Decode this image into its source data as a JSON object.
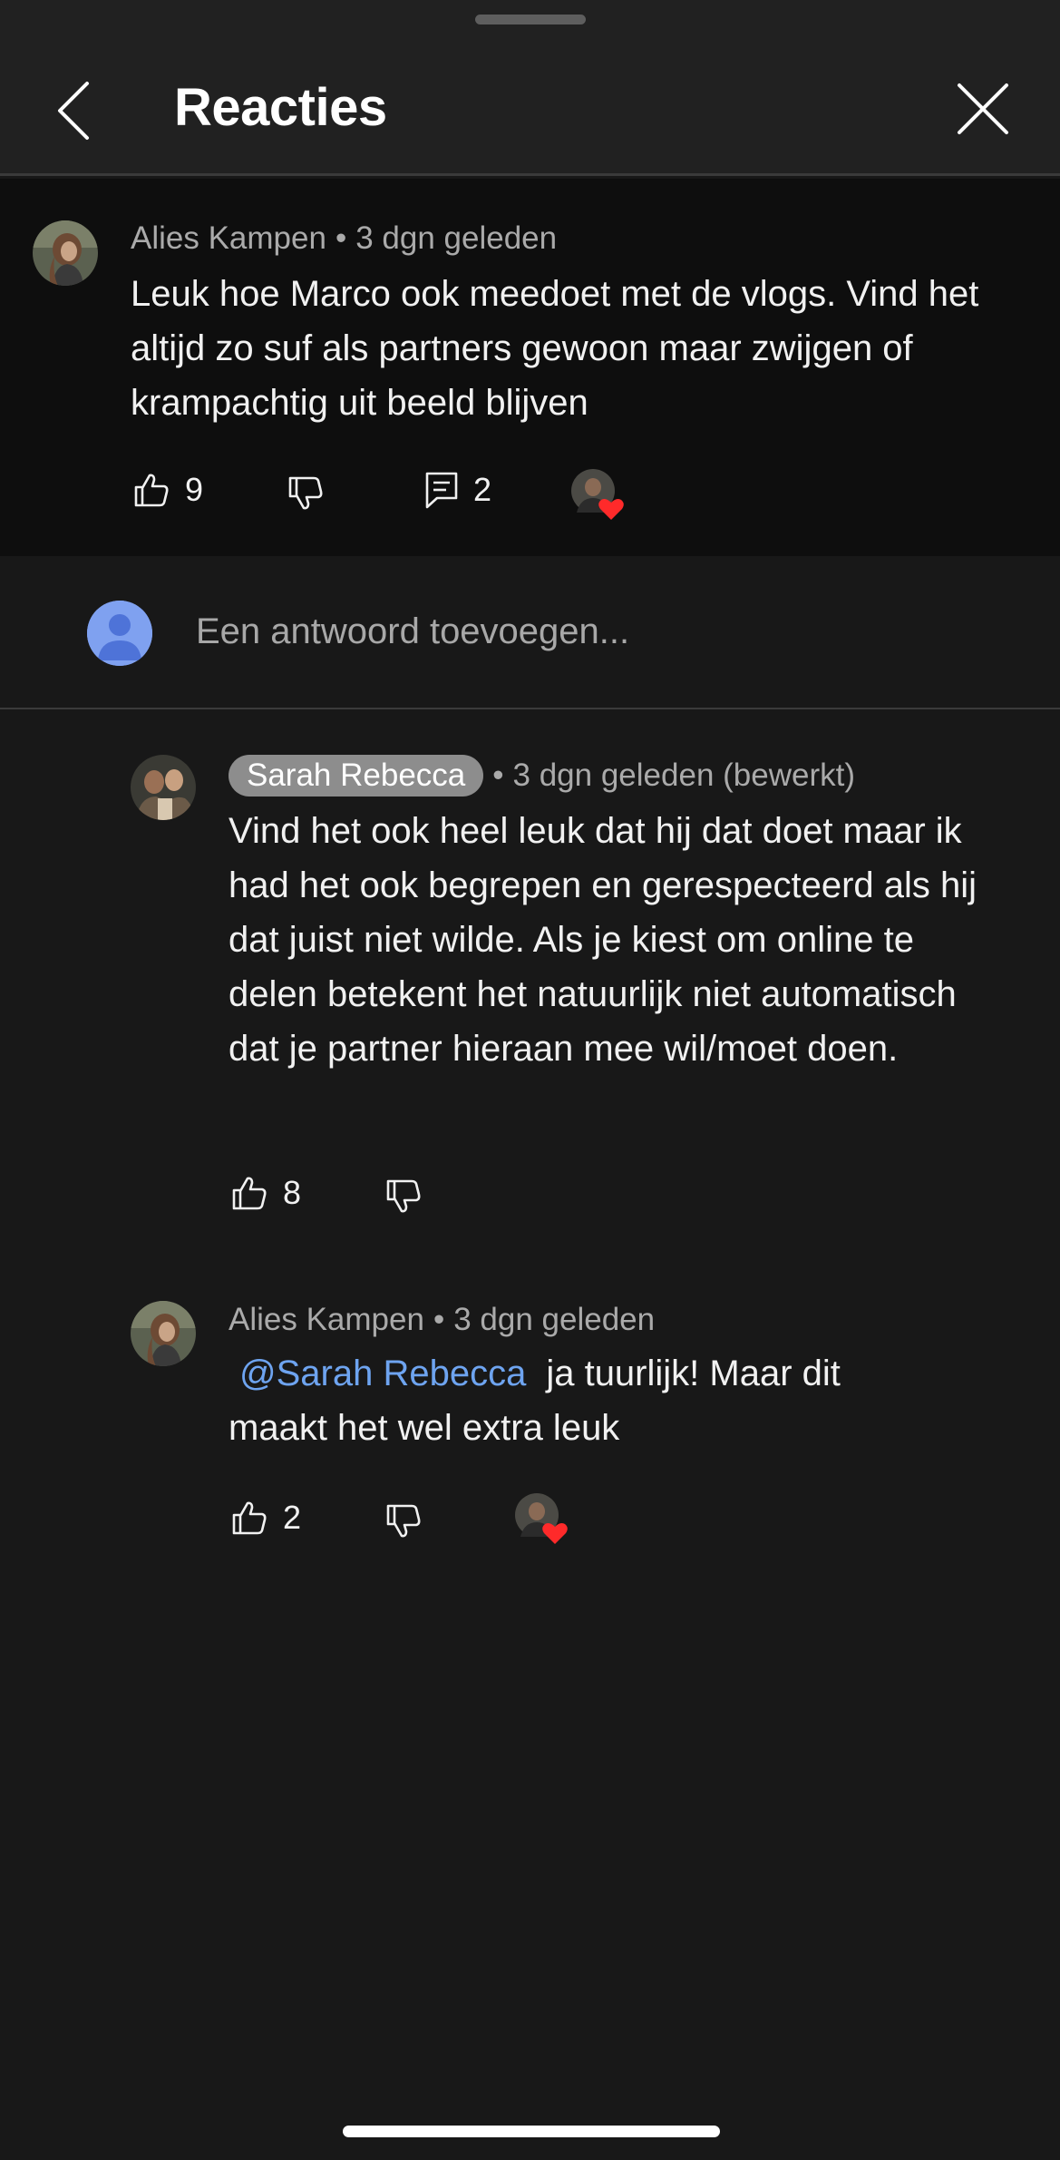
{
  "header": {
    "title": "Reacties"
  },
  "parent_comment": {
    "author": "Alies Kampen",
    "separator": "•",
    "time": "3 dgn geleden",
    "text": "Leuk hoe Marco ook meedoet met de vlogs. Vind het altijd zo suf als partners gewoon maar zwijgen of krampachtig uit beeld blijven",
    "likes": "9",
    "replies": "2"
  },
  "reply_box": {
    "placeholder": "Een antwoord toevoegen..."
  },
  "replies": [
    {
      "author": "Sarah Rebecca",
      "separator": "•",
      "time": "3 dgn geleden (bewerkt)",
      "text": "Vind het ook heel leuk dat hij dat doet maar ik had het ook begrepen en gerespecteerd als hij dat juist niet wilde. Als je kiest om online te delen betekent het natuurlijk niet automatisch dat je partner hieraan mee wil/moet doen.",
      "likes": "8"
    },
    {
      "author": "Alies Kampen",
      "separator": "•",
      "time": "3 dgn geleden",
      "mention": "@Sarah Rebecca",
      "text": "ja tuurlijk! Maar dit maakt het wel extra leuk",
      "likes": "2"
    }
  ],
  "icons": {
    "back": "chevron-left-icon",
    "close": "close-icon",
    "like": "thumbs-up-icon",
    "dislike": "thumbs-down-icon",
    "reply": "comment-icon",
    "creator_heart": "heart-icon"
  },
  "colors": {
    "background": "#181818",
    "parent_background": "#0e0e0e",
    "mention": "#6ea4f0",
    "heart": "#ff2a2a",
    "avatar_default": "#7fa1f0"
  }
}
